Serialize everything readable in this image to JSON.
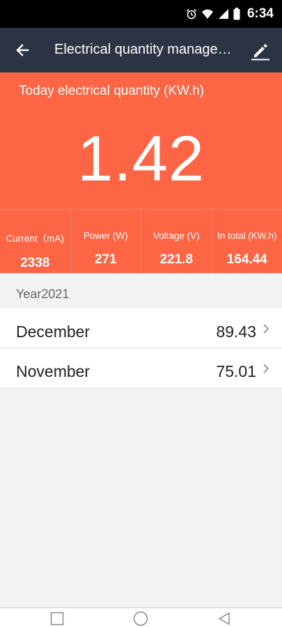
{
  "status_bar": {
    "time": "6:34",
    "icons": [
      "alarm-icon",
      "wifi-icon",
      "signal-icon",
      "battery-icon"
    ]
  },
  "app_bar": {
    "title": "Electrical quantity manage…",
    "back_icon": "arrow-left-icon",
    "edit_icon": "pencil-icon"
  },
  "today": {
    "label": "Today electrical quantity (KW.h)",
    "value": "1.42"
  },
  "stats": [
    {
      "label": "Current（mA)",
      "value": "2338"
    },
    {
      "label": "Power (W)",
      "value": "271"
    },
    {
      "label": "Voltage (V)",
      "value": "221.8"
    },
    {
      "label": "In total (KW.h)",
      "value": "164.44"
    }
  ],
  "year": {
    "label": "Year2021"
  },
  "months": [
    {
      "name": "December",
      "value": "89.43"
    },
    {
      "name": "November",
      "value": "75.01"
    }
  ],
  "colors": {
    "accent": "#fd6544",
    "app_bar": "#2c3443",
    "background": "#f3f3f3"
  }
}
